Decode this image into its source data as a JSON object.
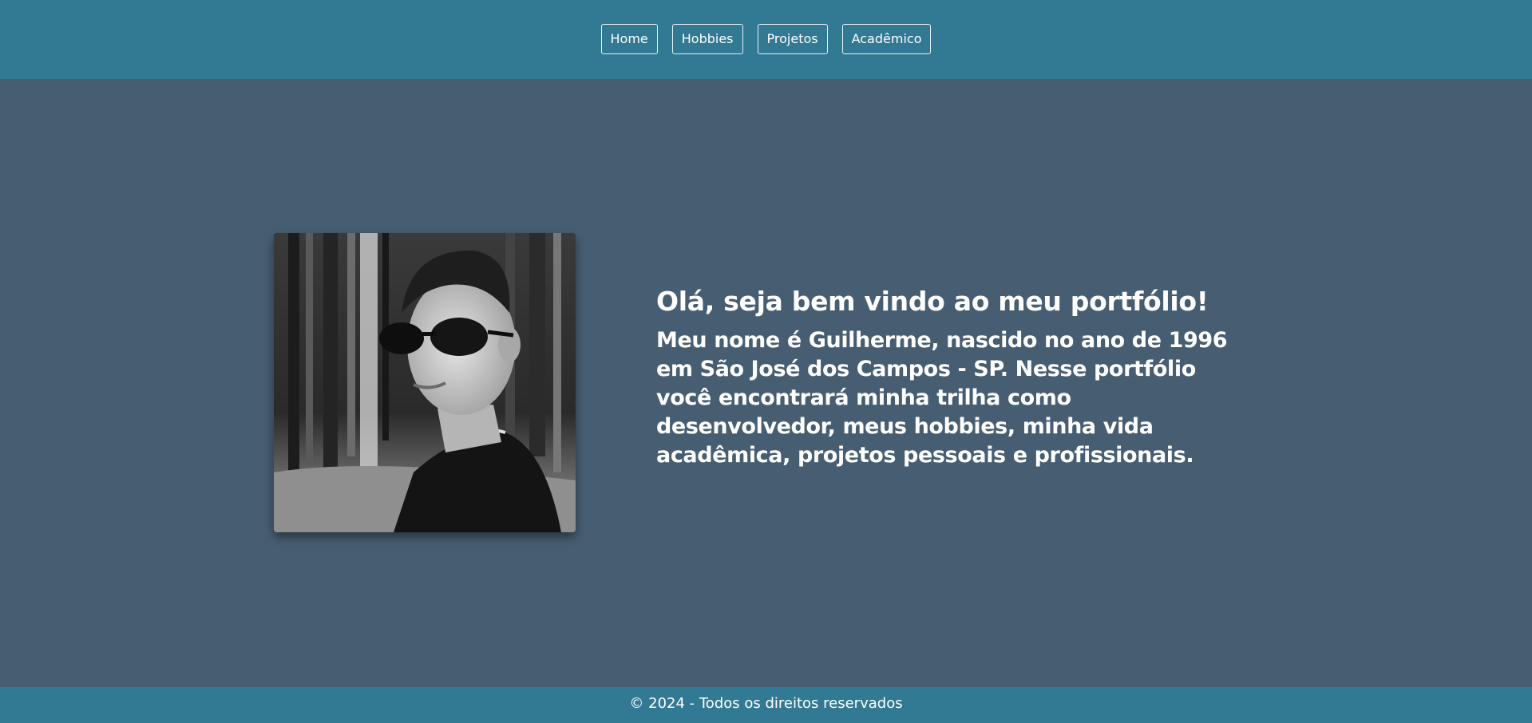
{
  "nav": {
    "items": [
      {
        "label": "Home"
      },
      {
        "label": "Hobbies"
      },
      {
        "label": "Projetos"
      },
      {
        "label": "Acadêmico"
      }
    ]
  },
  "hero": {
    "title": "Olá, seja bem vindo ao meu portfólio!",
    "description": "Meu nome é Guilherme, nascido no ano de 1996 em São José dos Campos - SP. Nesse portfólio você encontrará minha trilha como desenvolvedor, meus hobbies, minha vida acadêmica, projetos pessoais e profissionais."
  },
  "footer": {
    "text": "© 2024 - Todos os direitos reservados"
  },
  "colors": {
    "header_bg": "#327993",
    "main_bg": "#475e72",
    "footer_bg": "#327993",
    "text": "#ffffff"
  }
}
